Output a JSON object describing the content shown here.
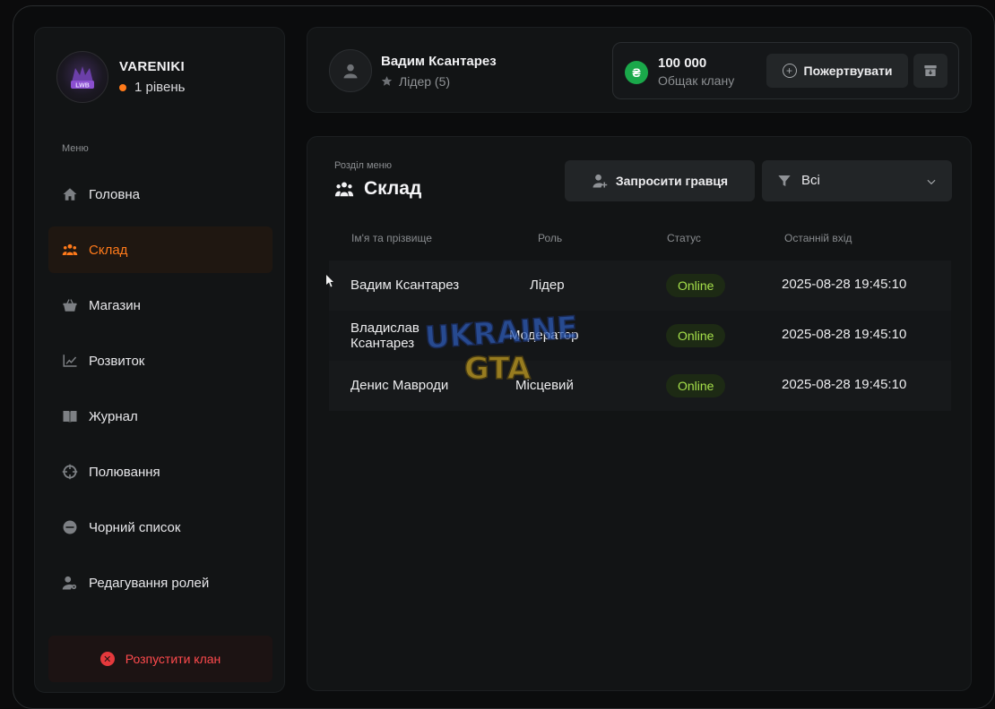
{
  "clan": {
    "name": "VARENIKI",
    "level": "1 рівень",
    "logo_text": "LWB"
  },
  "sidebar": {
    "caption": "Меню",
    "items": [
      {
        "label": "Головна",
        "icon": "home-icon",
        "active": false
      },
      {
        "label": "Склад",
        "icon": "people-icon",
        "active": true
      },
      {
        "label": "Магазин",
        "icon": "basket-icon",
        "active": false
      },
      {
        "label": "Розвиток",
        "icon": "chart-line-icon",
        "active": false
      },
      {
        "label": "Журнал",
        "icon": "book-icon",
        "active": false
      },
      {
        "label": "Полювання",
        "icon": "crosshair-icon",
        "active": false
      },
      {
        "label": "Чорний список",
        "icon": "minus-circle-icon",
        "active": false
      },
      {
        "label": "Редагування ролей",
        "icon": "user-gear-icon",
        "active": false
      }
    ],
    "disband_label": "Розпустити клан"
  },
  "header": {
    "user_name": "Вадим Ксантарез",
    "user_role": "Лідер (5)",
    "bank_symbol": "₴",
    "bank_amount": "100 000",
    "bank_caption": "Общак клану",
    "donate_label": "Пожертвувати"
  },
  "main": {
    "caption": "Розділ меню",
    "title": "Склад",
    "invite_label": "Запросити гравця",
    "filter_value": "Всі",
    "columns": [
      "Ім'я та прізвище",
      "Роль",
      "Статус",
      "Останній вхід"
    ],
    "rows": [
      {
        "name": "Вадим Ксантарез",
        "role": "Лідер",
        "status": "Online",
        "last_login": "2025-08-28 19:45:10"
      },
      {
        "name": "Владислав Ксантарез",
        "role": "Модератор",
        "status": "Online",
        "last_login": "2025-08-28 19:45:10"
      },
      {
        "name": "Денис Мавроди",
        "role": "Місцевий",
        "status": "Online",
        "last_login": "2025-08-28 19:45:10"
      }
    ]
  },
  "watermark": {
    "line1": "UKRAINE",
    "line2": "GTA"
  },
  "colors": {
    "accent": "#ff7a1a",
    "online": "#a6e04a",
    "danger": "#ff4a4d",
    "coin": "#1aa84a"
  }
}
